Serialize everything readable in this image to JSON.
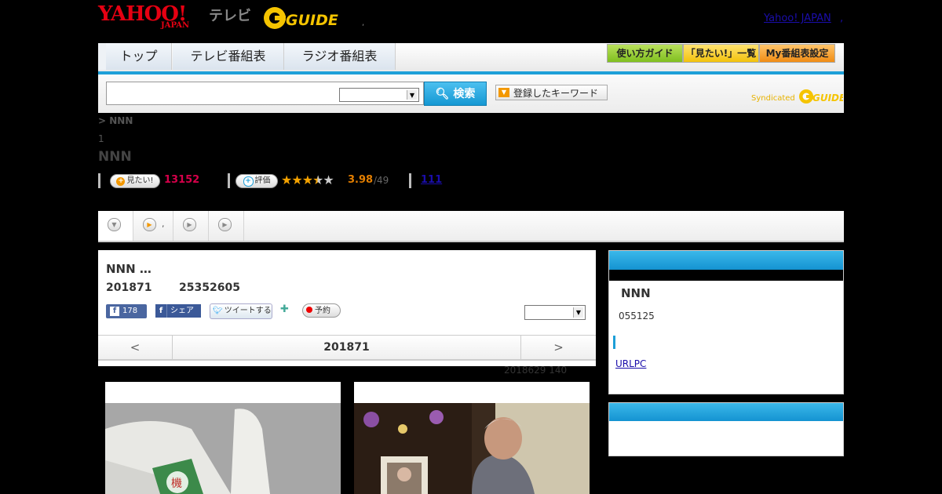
{
  "header": {
    "yahoo_logo": "YAHOO!",
    "japan_logo": "JAPAN",
    "tv_label": "テレビ",
    "gguide_logo": "G-GUIDE",
    "separator": ",",
    "yahoo_japan_link": "Yahoo! JAPAN",
    "link_separator": ","
  },
  "nav": {
    "tabs": [
      {
        "label": "トップ"
      },
      {
        "label": "テレビ番組表"
      },
      {
        "label": "ラジオ番組表"
      }
    ],
    "buttons": [
      {
        "label": "使い方ガイド"
      },
      {
        "label": "「見たい!」一覧"
      },
      {
        "label": "My番組表設定"
      }
    ]
  },
  "search": {
    "input_value": "",
    "select_value": "",
    "button_label": "検索",
    "keyword_button": "登録したキーワード",
    "syndicated_label": "Syndicated"
  },
  "program": {
    "breadcrumb": "> NNN",
    "episode_no": "1",
    "title": "NNN",
    "want_label": "見たい!",
    "want_count": "13152",
    "rate_label": "評価",
    "stars": {
      "filled": 3,
      "half": 1,
      "total": 5
    },
    "rating": "3.98",
    "rating_count": "/49",
    "review_link": "111"
  },
  "tabs": {
    "items": [
      {
        "label": ""
      },
      {
        "label": ","
      },
      {
        "label": ""
      },
      {
        "label": ""
      }
    ]
  },
  "episode": {
    "title": "NNN …",
    "date": "201871",
    "time": "25352605",
    "like_count": "178",
    "share_label": "シェア",
    "tweet_label": "ツイートする",
    "reserve_label": "予約",
    "select_value": "",
    "prev": "<",
    "next": ">",
    "current_date": "201871",
    "updated": "2018629  140"
  },
  "sidebar": {
    "name": "NNN",
    "number": "055125",
    "link": "URLPC"
  },
  "colors": {
    "accent_blue": "#1d9fd8",
    "yahoo_red": "#e60012",
    "want_pink": "#d6004a",
    "rating_orange": "#e37e00"
  }
}
